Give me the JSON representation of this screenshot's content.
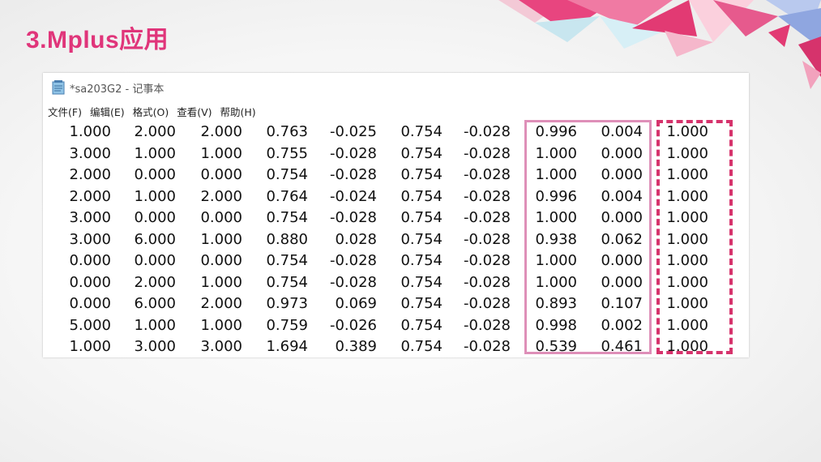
{
  "slide": {
    "title": "3.Mplus应用"
  },
  "window": {
    "title": "*sa203G2 - 记事本"
  },
  "menu": [
    "文件(F)",
    "编辑(E)",
    "格式(O)",
    "查看(V)",
    "帮助(H)"
  ],
  "rows": [
    [
      "1.000",
      "2.000",
      "2.000",
      "0.763",
      "-0.025",
      "0.754",
      "-0.028",
      "0.996",
      "0.004",
      "1.000"
    ],
    [
      "3.000",
      "1.000",
      "1.000",
      "0.755",
      "-0.028",
      "0.754",
      "-0.028",
      "1.000",
      "0.000",
      "1.000"
    ],
    [
      "2.000",
      "0.000",
      "0.000",
      "0.754",
      "-0.028",
      "0.754",
      "-0.028",
      "1.000",
      "0.000",
      "1.000"
    ],
    [
      "2.000",
      "1.000",
      "2.000",
      "0.764",
      "-0.024",
      "0.754",
      "-0.028",
      "0.996",
      "0.004",
      "1.000"
    ],
    [
      "3.000",
      "0.000",
      "0.000",
      "0.754",
      "-0.028",
      "0.754",
      "-0.028",
      "1.000",
      "0.000",
      "1.000"
    ],
    [
      "3.000",
      "6.000",
      "1.000",
      "0.880",
      "0.028",
      "0.754",
      "-0.028",
      "0.938",
      "0.062",
      "1.000"
    ],
    [
      "0.000",
      "0.000",
      "0.000",
      "0.754",
      "-0.028",
      "0.754",
      "-0.028",
      "1.000",
      "0.000",
      "1.000"
    ],
    [
      "0.000",
      "2.000",
      "1.000",
      "0.754",
      "-0.028",
      "0.754",
      "-0.028",
      "1.000",
      "0.000",
      "1.000"
    ],
    [
      "0.000",
      "6.000",
      "2.000",
      "0.973",
      "0.069",
      "0.754",
      "-0.028",
      "0.893",
      "0.107",
      "1.000"
    ],
    [
      "5.000",
      "1.000",
      "1.000",
      "0.759",
      "-0.026",
      "0.754",
      "-0.028",
      "0.998",
      "0.002",
      "1.000"
    ],
    [
      "1.000",
      "3.000",
      "3.000",
      "1.694",
      "0.389",
      "0.754",
      "-0.028",
      "0.539",
      "0.461",
      "1.000"
    ]
  ],
  "colors": {
    "title": "#e0357a",
    "solid_box": "#de8fb8",
    "dashed_box": "#d6336c"
  }
}
